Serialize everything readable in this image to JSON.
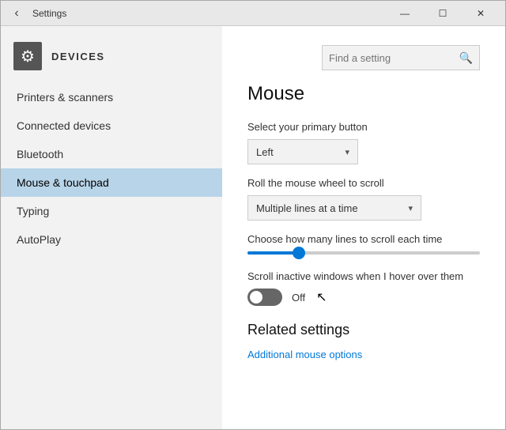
{
  "titlebar": {
    "back_label": "‹",
    "title": "Settings",
    "min_label": "—",
    "max_label": "☐",
    "close_label": "✕"
  },
  "sidebar": {
    "header_title": "DEVICES",
    "header_icon": "⚙",
    "items": [
      {
        "label": "Printers & scanners",
        "active": false
      },
      {
        "label": "Connected devices",
        "active": false
      },
      {
        "label": "Bluetooth",
        "active": false
      },
      {
        "label": "Mouse & touchpad",
        "active": true
      },
      {
        "label": "Typing",
        "active": false
      },
      {
        "label": "AutoPlay",
        "active": false
      }
    ]
  },
  "search": {
    "placeholder": "Find a setting"
  },
  "content": {
    "title": "Mouse",
    "primary_button_label": "Select your primary button",
    "primary_button_value": "Left",
    "scroll_wheel_label": "Roll the mouse wheel to scroll",
    "scroll_wheel_value": "Multiple lines at a time",
    "scroll_lines_label": "Choose how many lines to scroll each time",
    "scroll_inactive_label": "Scroll inactive windows when I hover over them",
    "toggle_state": "Off",
    "related_title": "Related settings",
    "related_link": "Additional mouse options"
  }
}
